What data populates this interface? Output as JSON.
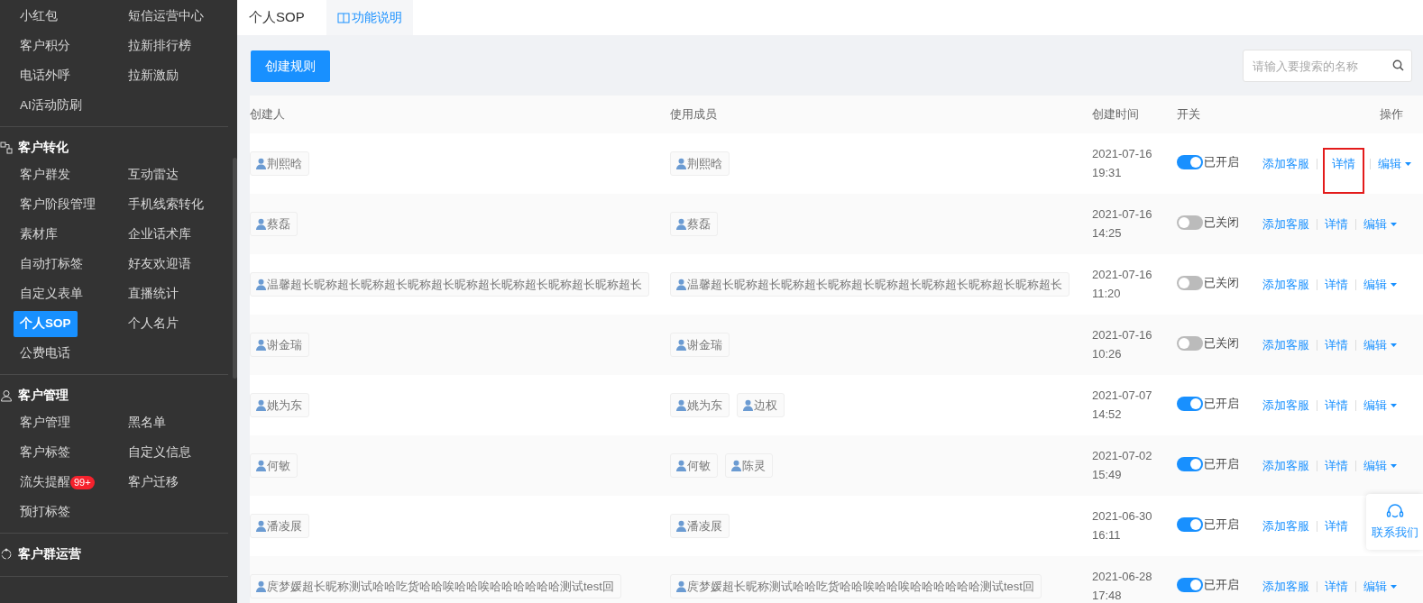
{
  "sidebar": {
    "groups": [
      {
        "items": [
          {
            "label": "小红包",
            "selected": false
          },
          {
            "label": "短信运营中心",
            "selected": false
          },
          {
            "label": "客户积分",
            "selected": false
          },
          {
            "label": "拉新排行榜",
            "selected": false
          },
          {
            "label": "电话外呼",
            "selected": false
          },
          {
            "label": "拉新激励",
            "selected": false
          },
          {
            "label": "AI活动防刷",
            "selected": false
          }
        ]
      },
      {
        "title": "客户转化",
        "items": [
          {
            "label": "客户群发",
            "selected": false
          },
          {
            "label": "互动雷达",
            "selected": false
          },
          {
            "label": "客户阶段管理",
            "selected": false
          },
          {
            "label": "手机线索转化",
            "selected": false
          },
          {
            "label": "素材库",
            "selected": false
          },
          {
            "label": "企业话术库",
            "selected": false
          },
          {
            "label": "自动打标签",
            "selected": false
          },
          {
            "label": "好友欢迎语",
            "selected": false
          },
          {
            "label": "自定义表单",
            "selected": false
          },
          {
            "label": "直播统计",
            "selected": false
          },
          {
            "label": "个人SOP",
            "selected": true
          },
          {
            "label": "个人名片",
            "selected": false
          },
          {
            "label": "公费电话",
            "selected": false
          }
        ]
      },
      {
        "title": "客户管理",
        "items": [
          {
            "label": "客户管理",
            "selected": false
          },
          {
            "label": "黑名单",
            "selected": false
          },
          {
            "label": "客户标签",
            "selected": false
          },
          {
            "label": "自定义信息",
            "selected": false
          },
          {
            "label": "流失提醒",
            "selected": false,
            "badge": "99+"
          },
          {
            "label": "客户迁移",
            "selected": false
          },
          {
            "label": "预打标签",
            "selected": false
          }
        ]
      },
      {
        "title": "客户群运营"
      }
    ]
  },
  "header": {
    "title": "个人SOP",
    "help_link": "功能说明"
  },
  "toolbar": {
    "create_button": "创建规则",
    "search": {
      "placeholder": "请输入要搜索的名称"
    }
  },
  "table": {
    "columns": [
      "创建人",
      "使用成员",
      "创建时间",
      "开关",
      "操作"
    ],
    "rows": [
      {
        "creator": [
          "荆熙晗"
        ],
        "members": [
          "荆熙晗"
        ],
        "date": "2021-07-16",
        "time": "19:31",
        "on": true,
        "status": "已开启",
        "actions": {
          "add": "添加客服",
          "details": "详情",
          "edit": "编辑"
        },
        "details_highlighted": true
      },
      {
        "creator": [
          "蔡磊"
        ],
        "members": [
          "蔡磊"
        ],
        "date": "2021-07-16",
        "time": "14:25",
        "on": false,
        "status": "已关闭",
        "actions": {
          "add": "添加客服",
          "details": "详情",
          "edit": "编辑"
        },
        "details_highlighted": false
      },
      {
        "creator": [
          "温馨超长昵称超长昵称超长昵称超长昵称超长昵称超长昵称超长昵称超长"
        ],
        "members": [
          "温馨超长昵称超长昵称超长昵称超长昵称超长昵称超长昵称超长昵称超长"
        ],
        "date": "2021-07-16",
        "time": "11:20",
        "on": false,
        "status": "已关闭",
        "actions": {
          "add": "添加客服",
          "details": "详情",
          "edit": "编辑"
        },
        "details_highlighted": false
      },
      {
        "creator": [
          "谢金瑞"
        ],
        "members": [
          "谢金瑞"
        ],
        "date": "2021-07-16",
        "time": "10:26",
        "on": false,
        "status": "已关闭",
        "actions": {
          "add": "添加客服",
          "details": "详情",
          "edit": "编辑"
        },
        "details_highlighted": false
      },
      {
        "creator": [
          "姚为东"
        ],
        "members": [
          "姚为东",
          "边权"
        ],
        "date": "2021-07-07",
        "time": "14:52",
        "on": true,
        "status": "已开启",
        "actions": {
          "add": "添加客服",
          "details": "详情",
          "edit": "编辑"
        },
        "details_highlighted": false
      },
      {
        "creator": [
          "何敏"
        ],
        "members": [
          "何敏",
          "陈灵"
        ],
        "date": "2021-07-02",
        "time": "15:49",
        "on": true,
        "status": "已开启",
        "actions": {
          "add": "添加客服",
          "details": "详情",
          "edit": "编辑"
        },
        "details_highlighted": false
      },
      {
        "creator": [
          "潘凌展"
        ],
        "members": [
          "潘凌展"
        ],
        "date": "2021-06-30",
        "time": "16:11",
        "on": true,
        "status": "已开启",
        "actions": {
          "add": "添加客服",
          "details": "详情"
        },
        "details_highlighted": false
      },
      {
        "creator": [
          "庹梦媛超长昵称测试哈哈吃货哈哈唉哈哈唉哈哈哈哈哈哈测试test回"
        ],
        "members": [
          "庹梦媛超长昵称测试哈哈吃货哈哈唉哈哈唉哈哈哈哈哈哈测试test回"
        ],
        "date": "2021-06-28",
        "time": "17:48",
        "on": true,
        "status": "已开启",
        "actions": {
          "add": "添加客服",
          "details": "详情",
          "edit": "编辑"
        },
        "details_highlighted": false
      }
    ]
  },
  "contact_widget": {
    "label": "联系我们"
  }
}
